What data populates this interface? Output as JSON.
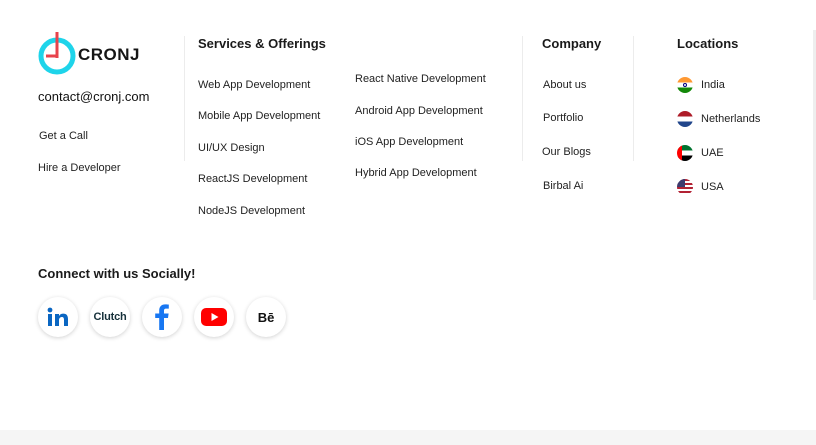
{
  "brand": {
    "name": "CRONJ",
    "accent": "#1ed4ea",
    "mark_color": "#e8424b"
  },
  "contact": {
    "email": "contact@cronj.com",
    "get_a_call": "Get a Call",
    "hire": "Hire a Developer"
  },
  "services": {
    "heading": "Services & Offerings",
    "col1": [
      "Web App Development",
      "Mobile App Development",
      "UI/UX Design",
      "ReactJS Development",
      "NodeJS Development"
    ],
    "col2": [
      "React Native Development",
      "Android App Development",
      "iOS App Development",
      "Hybrid App Development"
    ]
  },
  "company": {
    "heading": "Company",
    "items": [
      "About us",
      "Portfolio",
      "Our Blogs",
      "Birbal Ai"
    ]
  },
  "locations": {
    "heading": "Locations",
    "items": [
      {
        "label": "India",
        "icon": "india-flag-icon"
      },
      {
        "label": "Netherlands",
        "icon": "netherlands-flag-icon"
      },
      {
        "label": "UAE",
        "icon": "uae-flag-icon"
      },
      {
        "label": "USA",
        "icon": "usa-flag-icon"
      }
    ]
  },
  "social": {
    "heading": "Connect with us Socially!",
    "clutch_label": "Clutch",
    "behance_label": "Bē",
    "icons": [
      "linkedin-icon",
      "clutch-icon",
      "facebook-icon",
      "youtube-icon",
      "behance-icon"
    ]
  }
}
